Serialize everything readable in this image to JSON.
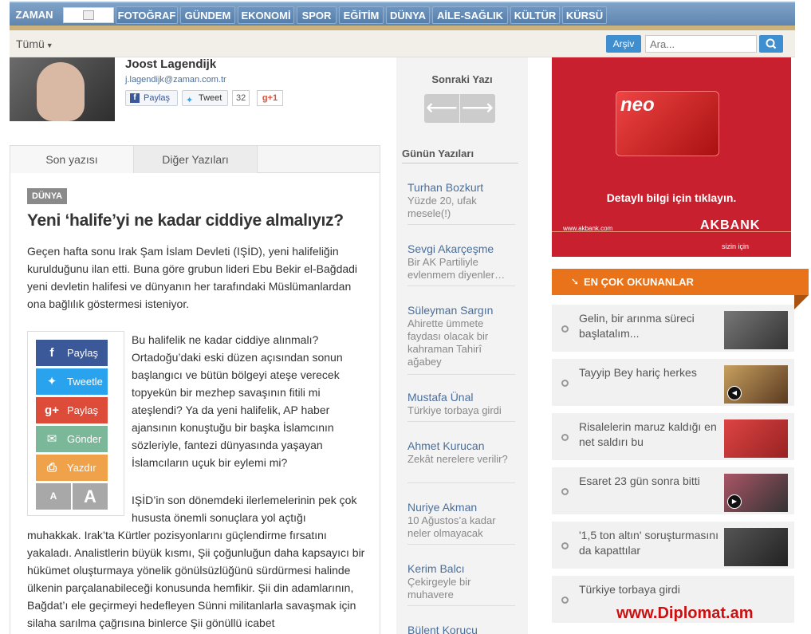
{
  "nav": {
    "brand": "ZAMAN",
    "items": [
      "FOTOĞRAF",
      "GÜNDEM",
      "EKONOMİ",
      "SPOR",
      "EĞİTİM",
      "DÜNYA",
      "AİLE-SAĞLIK",
      "KÜLTÜR",
      "KÜRSÜ"
    ]
  },
  "toolbar": {
    "filter_label": "Tümü",
    "archive_label": "Arşiv",
    "search_placeholder": "Ara..."
  },
  "author": {
    "name": "Joost Lagendijk",
    "email": "j.lagendijk@zaman.com.tr",
    "fb_label": "Paylaş",
    "tweet_label": "Tweet",
    "tweet_count": "32",
    "gplus_label": "+1"
  },
  "tabs": [
    "Son yazısı",
    "Diğer Yazıları"
  ],
  "article": {
    "category": "DÜNYA",
    "headline": "Yeni ‘halife’yi ne kadar ciddiye almalıyız?",
    "p1": "Geçen hafta sonu Irak Şam İslam Devleti (IŞİD), yeni halifeliğin kurulduğunu ilan etti. Buna göre grubun lideri Ebu Bekir el-Bağdadi yeni devletin halifesi ve dünyanın her tarafındaki Müslümanlardan ona bağlılık göstermesi isteniyor.",
    "p2": "Bu halifelik ne kadar ciddiye alınmalı? Ortadoğu’daki eski düzen açısından sonun başlangıcı ve bütün bölgeyi ateşe verecek topyekün bir mezhep savaşının fitili mi ateşlendi? Ya da yeni halifelik, AP haber ajansının konuştuğu bir başka İslamcının sözleriyle, fantezi dünyasında yaşayan İslamcıların uçuk bir eylemi mi?",
    "p3a": "IŞİD’in son dönemdeki ilerlemelerinin pek çok hususta önemli sonuçlara yol açtığı",
    "p3b": "muhakkak. Irak’ta Kürtler pozisyonlarını güçlendirme fırsatını yakaladı. Analistlerin büyük kısmı, Şii çoğunluğun daha kapsayıcı bir hükümet oluşturmaya yönelik gönülsüzlüğünü sürdürmesi halinde ülkenin parçalanabileceği konusunda hemfikir. Şii din adamlarının, Bağdat’ı ele geçirmeyi hedefleyen Sünni militanlarla savaşmak için silaha sarılma çağrısına binlerce Şii gönüllü icabet"
  },
  "share": {
    "facebook": "Paylaş",
    "twitter": "Tweetle",
    "gplus": "Paylaş",
    "mail": "Gönder",
    "print": "Yazdır",
    "font_small": "A",
    "font_large": "A"
  },
  "middle": {
    "next_title": "Sonraki Yazı",
    "daily_title": "Günün Yazıları",
    "items": [
      {
        "author": "Turhan Bozkurt",
        "title": "Yüzde 20, ufak mesele(!)"
      },
      {
        "author": "Sevgi Akarçeşme",
        "title": "Bir AK Partiliyle evlenmem diyenler…"
      },
      {
        "author": "Süleyman Sargın",
        "title": "Ahirette ümmete faydası olacak bir kahraman Tahirî ağabey"
      },
      {
        "author": "Mustafa Ünal",
        "title": "Türkiye torbaya girdi"
      },
      {
        "author": "Ahmet Kurucan",
        "title": "Zekât nerelere verilir?"
      },
      {
        "author": "Nuriye Akman",
        "title": "10 Ağustos’a kadar neler olmayacak"
      },
      {
        "author": "Kerim Balcı",
        "title": "Çekirgeyle bir muhavere"
      },
      {
        "author": "Bülent Korucu",
        "title": ""
      }
    ]
  },
  "ad": {
    "card_text": "neo",
    "cta": "Detaylı bilgi için tıklayın.",
    "url": "www.akbank.com",
    "brand": "AKBANK",
    "slogan": "sizin için"
  },
  "most_read": {
    "header": "EN ÇOK OKUNANLAR",
    "items": [
      {
        "title": "Gelin, bir arınma süreci başlatalım...",
        "video": false
      },
      {
        "title": "Tayyip Bey hariç herkes",
        "video": true
      },
      {
        "title": "Risalelerin maruz kaldığı en net saldırı bu",
        "video": false
      },
      {
        "title": "Esaret 23 gün sonra bitti",
        "video": true
      },
      {
        "title": "'1,5 ton altın' soruşturmasını da kapattılar",
        "video": false
      },
      {
        "title": "Türkiye torbaya girdi",
        "video": false
      }
    ]
  },
  "watermark": "www.Diplomat.am"
}
